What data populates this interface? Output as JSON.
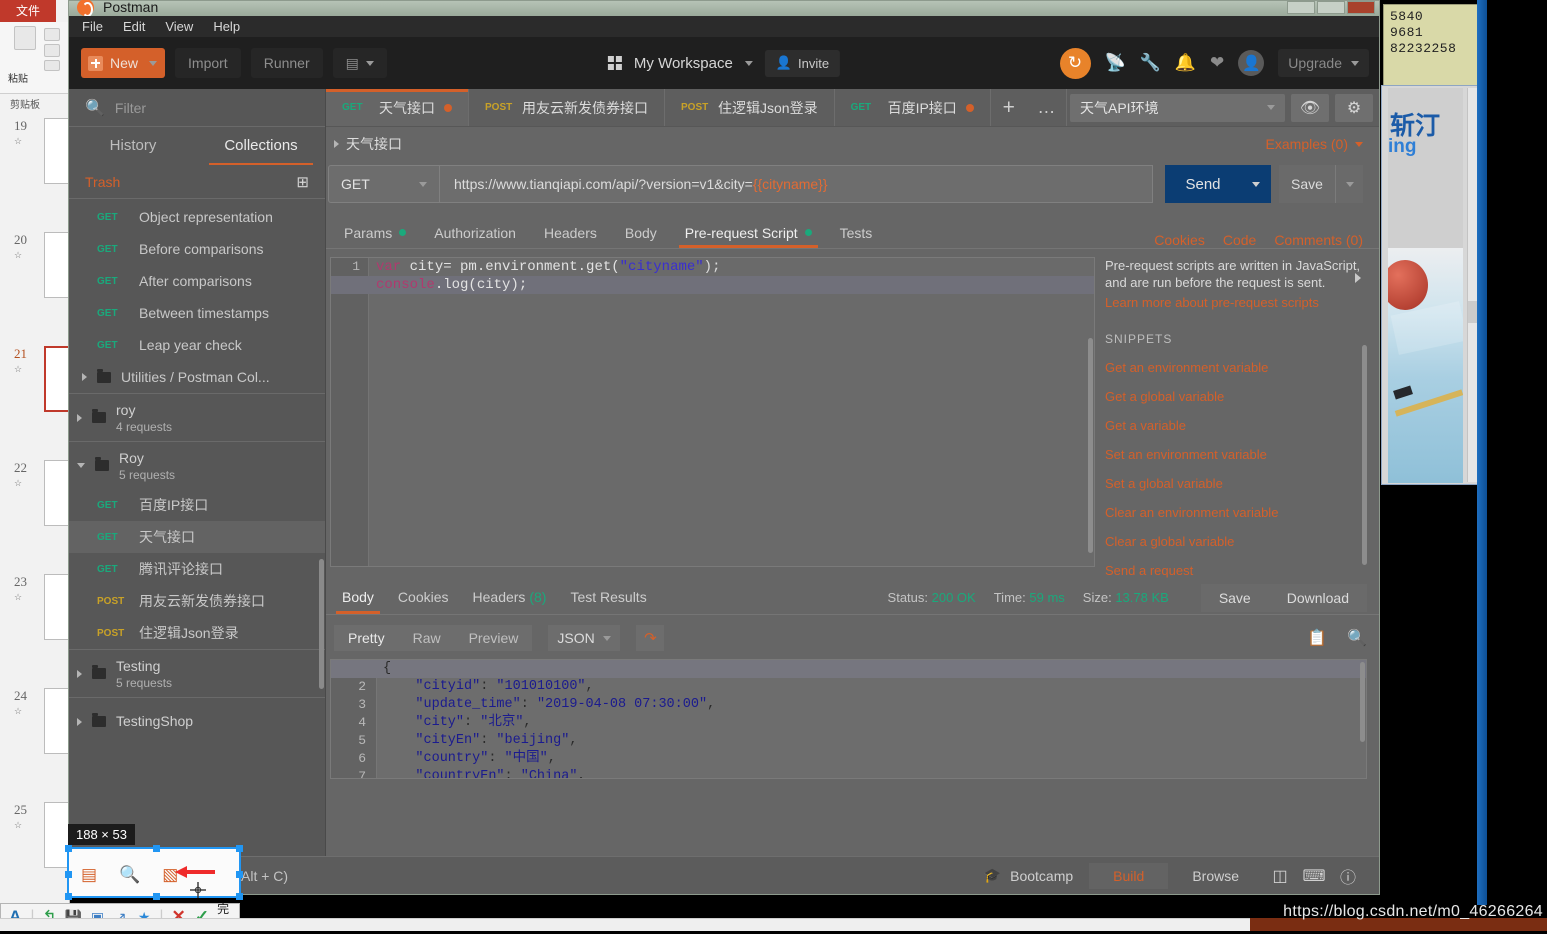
{
  "desktop": {
    "ppt": {
      "ribbon_tab": "文件",
      "paste_label": "粘贴",
      "clipboard_label": "剪贴板",
      "slides": [
        {
          "number": "19",
          "selected": false
        },
        {
          "number": "20",
          "selected": false
        },
        {
          "number": "21",
          "selected": true
        },
        {
          "number": "22",
          "selected": false
        },
        {
          "number": "23",
          "selected": false
        },
        {
          "number": "24",
          "selected": false
        },
        {
          "number": "25",
          "selected": false
        }
      ]
    },
    "note_lines": [
      "5840",
      "9681",
      "82232258"
    ],
    "image_window": {
      "text1": "斩汀",
      "text2": "ing"
    },
    "watermark": "https://blog.csdn.net/m0_46266264"
  },
  "capture": {
    "size_label": "188 × 53",
    "tooltip": "Postman Console (Ctrl + Alt + C)",
    "toolbar_icons": [
      "panel-icon",
      "magnifier-icon",
      "console-icon"
    ],
    "done_label": "完成"
  },
  "window": {
    "title": "Postman",
    "menu": [
      "File",
      "Edit",
      "View",
      "Help"
    ]
  },
  "toolbar": {
    "new_label": "New",
    "import_label": "Import",
    "runner_label": "Runner",
    "workspace_label": "My Workspace",
    "invite_label": "Invite",
    "upgrade_label": "Upgrade"
  },
  "sidebar": {
    "filter_placeholder": "Filter",
    "tabs": [
      {
        "label": "History",
        "active": false
      },
      {
        "label": "Collections",
        "active": true
      }
    ],
    "trash_label": "Trash",
    "items": [
      {
        "type": "request",
        "verb": "GET",
        "name": "Object representation",
        "selected": false
      },
      {
        "type": "request",
        "verb": "GET",
        "name": "Before comparisons",
        "selected": false
      },
      {
        "type": "request",
        "verb": "GET",
        "name": "After comparisons",
        "selected": false
      },
      {
        "type": "request",
        "verb": "GET",
        "name": "Between timestamps",
        "selected": false
      },
      {
        "type": "request",
        "verb": "GET",
        "name": "Leap year check",
        "selected": false
      },
      {
        "type": "folder",
        "name": "Utilities / Postman Col...",
        "open": false
      },
      {
        "type": "collection",
        "name": "roy",
        "sub": "4 requests",
        "open": false
      },
      {
        "type": "collection",
        "name": "Roy",
        "sub": "5 requests",
        "open": true
      },
      {
        "type": "request",
        "verb": "GET",
        "name": "百度IP接口",
        "selected": false
      },
      {
        "type": "request",
        "verb": "GET",
        "name": "天气接口",
        "selected": true
      },
      {
        "type": "request",
        "verb": "GET",
        "name": "腾讯评论接口",
        "selected": false
      },
      {
        "type": "request",
        "verb": "POST",
        "name": "用友云新发债券接口",
        "selected": false
      },
      {
        "type": "request",
        "verb": "POST",
        "name": "住逻辑Json登录",
        "selected": false
      },
      {
        "type": "collection",
        "name": "Testing",
        "sub": "5 requests",
        "open": false
      },
      {
        "type": "collection",
        "name": "TestingShop",
        "sub": "",
        "open": false
      }
    ]
  },
  "request_tabs": [
    {
      "verb": "GET",
      "name": "天气接口",
      "dirty": true,
      "active": true
    },
    {
      "verb": "POST",
      "name": "用友云新发债券接口",
      "dirty": false,
      "active": false
    },
    {
      "verb": "POST",
      "name": "住逻辑Json登录",
      "dirty": false,
      "active": false
    },
    {
      "verb": "GET",
      "name": "百度IP接口",
      "dirty": true,
      "active": false
    }
  ],
  "environment": {
    "selected": "天气API环境"
  },
  "request": {
    "breadcrumb": "天气接口",
    "examples_label": "Examples (0)",
    "method": "GET",
    "url_prefix": "https://www.tianqiapi.com/api/?version=v1&city=",
    "url_variable": "{{cityname}}",
    "send_label": "Send",
    "save_label": "Save",
    "tabs": [
      {
        "label": "Params",
        "dot": true,
        "active": false
      },
      {
        "label": "Authorization",
        "dot": false,
        "active": false
      },
      {
        "label": "Headers",
        "dot": false,
        "active": false
      },
      {
        "label": "Body",
        "dot": false,
        "active": false
      },
      {
        "label": "Pre-request Script",
        "dot": true,
        "active": true
      },
      {
        "label": "Tests",
        "dot": false,
        "active": false
      }
    ],
    "meta_links": [
      "Cookies",
      "Code",
      "Comments (0)"
    ],
    "script_lines": [
      {
        "n": "1",
        "highlight": false,
        "parts": [
          {
            "t": "var ",
            "c": "k-var"
          },
          {
            "t": "city= pm.environment.get(",
            "c": "k-id"
          },
          {
            "t": "\"cityname\"",
            "c": "k-str"
          },
          {
            "t": ");",
            "c": "k-p"
          }
        ]
      },
      {
        "n": "2",
        "highlight": true,
        "parts": [
          {
            "t": "console",
            "c": "k-var"
          },
          {
            "t": ".log(city);",
            "c": "k-id"
          }
        ]
      }
    ]
  },
  "snippets": {
    "description": "Pre-request scripts are written in JavaScript, and are run before the request is sent.",
    "learn_more": "Learn more about pre-request scripts",
    "heading": "SNIPPETS",
    "items": [
      "Get an environment variable",
      "Get a global variable",
      "Get a variable",
      "Set an environment variable",
      "Set a global variable",
      "Clear an environment variable",
      "Clear a global variable",
      "Send a request"
    ]
  },
  "response": {
    "tabs": [
      {
        "label": "Body",
        "count": "",
        "active": true
      },
      {
        "label": "Cookies",
        "count": "",
        "active": false
      },
      {
        "label": "Headers",
        "count": "(8)",
        "active": false
      },
      {
        "label": "Test Results",
        "count": "",
        "active": false
      }
    ],
    "status_label": "Status:",
    "status_value": "200 OK",
    "time_label": "Time:",
    "time_value": "59 ms",
    "size_label": "Size:",
    "size_value": "13.78 KB",
    "save_label": "Save",
    "download_label": "Download",
    "format_tabs": [
      {
        "label": "Pretty",
        "active": true
      },
      {
        "label": "Raw",
        "active": false
      },
      {
        "label": "Preview",
        "active": false
      }
    ],
    "language": "JSON",
    "body_lines": [
      {
        "n": "1",
        "fold": true,
        "highlight": true,
        "parts": [
          {
            "t": "{",
            "c": "j-pun"
          }
        ]
      },
      {
        "n": "2",
        "fold": false,
        "highlight": false,
        "parts": [
          {
            "t": "    ",
            "c": "j-pun"
          },
          {
            "t": "\"cityid\"",
            "c": "j-key"
          },
          {
            "t": ": ",
            "c": "j-pun"
          },
          {
            "t": "\"101010100\"",
            "c": "j-val"
          },
          {
            "t": ",",
            "c": "j-pun"
          }
        ]
      },
      {
        "n": "3",
        "fold": false,
        "highlight": false,
        "parts": [
          {
            "t": "    ",
            "c": "j-pun"
          },
          {
            "t": "\"update_time\"",
            "c": "j-key"
          },
          {
            "t": ": ",
            "c": "j-pun"
          },
          {
            "t": "\"2019-04-08 07:30:00\"",
            "c": "j-val"
          },
          {
            "t": ",",
            "c": "j-pun"
          }
        ]
      },
      {
        "n": "4",
        "fold": false,
        "highlight": false,
        "parts": [
          {
            "t": "    ",
            "c": "j-pun"
          },
          {
            "t": "\"city\"",
            "c": "j-key"
          },
          {
            "t": ": ",
            "c": "j-pun"
          },
          {
            "t": "\"北京\"",
            "c": "j-val"
          },
          {
            "t": ",",
            "c": "j-pun"
          }
        ]
      },
      {
        "n": "5",
        "fold": false,
        "highlight": false,
        "parts": [
          {
            "t": "    ",
            "c": "j-pun"
          },
          {
            "t": "\"cityEn\"",
            "c": "j-key"
          },
          {
            "t": ": ",
            "c": "j-pun"
          },
          {
            "t": "\"beijing\"",
            "c": "j-val"
          },
          {
            "t": ",",
            "c": "j-pun"
          }
        ]
      },
      {
        "n": "6",
        "fold": false,
        "highlight": false,
        "parts": [
          {
            "t": "    ",
            "c": "j-pun"
          },
          {
            "t": "\"country\"",
            "c": "j-key"
          },
          {
            "t": ": ",
            "c": "j-pun"
          },
          {
            "t": "\"中国\"",
            "c": "j-val"
          },
          {
            "t": ",",
            "c": "j-pun"
          }
        ]
      },
      {
        "n": "7",
        "fold": false,
        "highlight": false,
        "parts": [
          {
            "t": "    ",
            "c": "j-pun"
          },
          {
            "t": "\"countryEn\"",
            "c": "j-key"
          },
          {
            "t": ": ",
            "c": "j-pun"
          },
          {
            "t": "\"China\"",
            "c": "j-val"
          },
          {
            "t": ",",
            "c": "j-pun"
          }
        ]
      }
    ]
  },
  "footer": {
    "bootcamp_label": "Bootcamp",
    "build_label": "Build",
    "browse_label": "Browse"
  },
  "colors": {
    "accent_orange": "#d4602a",
    "get_green": "#1aa97c",
    "post_yellow": "#c9a227",
    "send_blue": "#0b3d73"
  }
}
